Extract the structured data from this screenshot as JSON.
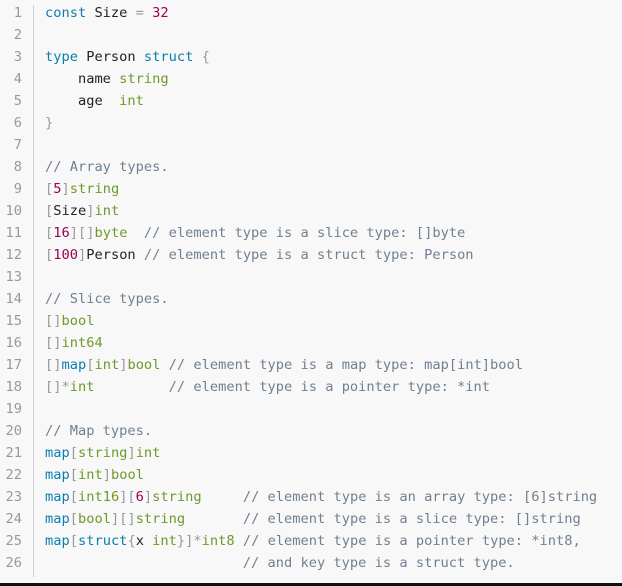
{
  "colors": {
    "keyword": "#0a7fae",
    "type": "#6d9a2c",
    "number": "#990055",
    "punctuation": "#999999",
    "comment": "#708090",
    "background": "#f8f8f8"
  },
  "lines": [
    [
      [
        "k",
        "const"
      ],
      [
        "x",
        " Size "
      ],
      [
        "p",
        "="
      ],
      [
        "x",
        " "
      ],
      [
        "n",
        "32"
      ]
    ],
    [],
    [
      [
        "k",
        "type"
      ],
      [
        "x",
        " Person "
      ],
      [
        "k",
        "struct"
      ],
      [
        "x",
        " "
      ],
      [
        "p",
        "{"
      ]
    ],
    [
      [
        "x",
        "    name "
      ],
      [
        "t",
        "string"
      ]
    ],
    [
      [
        "x",
        "    age  "
      ],
      [
        "t",
        "int"
      ]
    ],
    [
      [
        "p",
        "}"
      ]
    ],
    [],
    [
      [
        "c",
        "// Array types."
      ]
    ],
    [
      [
        "p",
        "["
      ],
      [
        "n",
        "5"
      ],
      [
        "p",
        "]"
      ],
      [
        "t",
        "string"
      ]
    ],
    [
      [
        "p",
        "["
      ],
      [
        "x",
        "Size"
      ],
      [
        "p",
        "]"
      ],
      [
        "t",
        "int"
      ]
    ],
    [
      [
        "p",
        "["
      ],
      [
        "n",
        "16"
      ],
      [
        "p",
        "][]"
      ],
      [
        "t",
        "byte"
      ],
      [
        "c",
        "  // element type is a slice type: []byte"
      ]
    ],
    [
      [
        "p",
        "["
      ],
      [
        "n",
        "100"
      ],
      [
        "p",
        "]"
      ],
      [
        "x",
        "Person"
      ],
      [
        "c",
        " // element type is a struct type: Person"
      ]
    ],
    [],
    [
      [
        "c",
        "// Slice types."
      ]
    ],
    [
      [
        "p",
        "[]"
      ],
      [
        "t",
        "bool"
      ]
    ],
    [
      [
        "p",
        "[]"
      ],
      [
        "t",
        "int64"
      ]
    ],
    [
      [
        "p",
        "[]"
      ],
      [
        "k",
        "map"
      ],
      [
        "p",
        "["
      ],
      [
        "t",
        "int"
      ],
      [
        "p",
        "]"
      ],
      [
        "t",
        "bool"
      ],
      [
        "c",
        " // element type is a map type: map[int]bool"
      ]
    ],
    [
      [
        "p",
        "[]*"
      ],
      [
        "t",
        "int"
      ],
      [
        "x",
        "         "
      ],
      [
        "c",
        "// element type is a pointer type: *int"
      ]
    ],
    [],
    [
      [
        "c",
        "// Map types."
      ]
    ],
    [
      [
        "k",
        "map"
      ],
      [
        "p",
        "["
      ],
      [
        "t",
        "string"
      ],
      [
        "p",
        "]"
      ],
      [
        "t",
        "int"
      ]
    ],
    [
      [
        "k",
        "map"
      ],
      [
        "p",
        "["
      ],
      [
        "t",
        "int"
      ],
      [
        "p",
        "]"
      ],
      [
        "t",
        "bool"
      ]
    ],
    [
      [
        "k",
        "map"
      ],
      [
        "p",
        "["
      ],
      [
        "t",
        "int16"
      ],
      [
        "p",
        "]["
      ],
      [
        "n",
        "6"
      ],
      [
        "p",
        "]"
      ],
      [
        "t",
        "string"
      ],
      [
        "x",
        "     "
      ],
      [
        "c",
        "// element type is an array type: [6]string"
      ]
    ],
    [
      [
        "k",
        "map"
      ],
      [
        "p",
        "["
      ],
      [
        "t",
        "bool"
      ],
      [
        "p",
        "][]"
      ],
      [
        "t",
        "string"
      ],
      [
        "x",
        "       "
      ],
      [
        "c",
        "// element type is a slice type: []string"
      ]
    ],
    [
      [
        "k",
        "map"
      ],
      [
        "p",
        "["
      ],
      [
        "k",
        "struct"
      ],
      [
        "p",
        "{"
      ],
      [
        "x",
        "x "
      ],
      [
        "t",
        "int"
      ],
      [
        "p",
        "}]*"
      ],
      [
        "t",
        "int8"
      ],
      [
        "x",
        " "
      ],
      [
        "c",
        "// element type is a pointer type: *int8,"
      ]
    ],
    [
      [
        "x",
        "                        "
      ],
      [
        "c",
        "// and key type is a struct type."
      ]
    ]
  ],
  "line_numbers": [
    "1",
    "2",
    "3",
    "4",
    "5",
    "6",
    "7",
    "8",
    "9",
    "10",
    "11",
    "12",
    "13",
    "14",
    "15",
    "16",
    "17",
    "18",
    "19",
    "20",
    "21",
    "22",
    "23",
    "24",
    "25",
    "26"
  ]
}
